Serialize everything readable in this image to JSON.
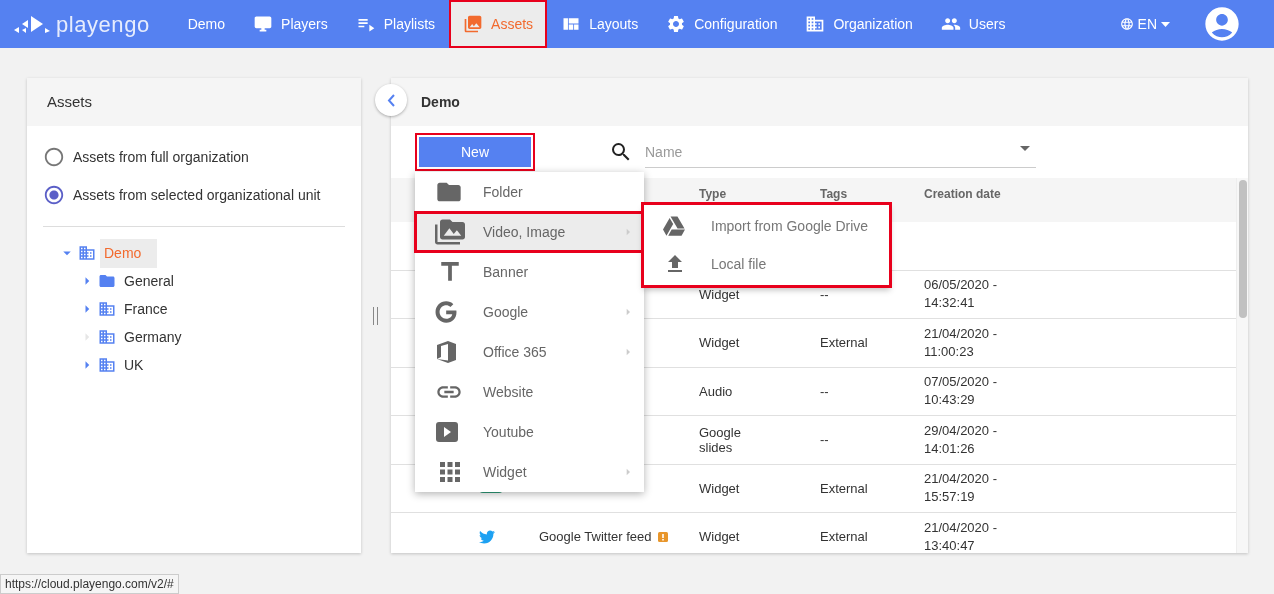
{
  "nav": {
    "logo": "playengo",
    "items": [
      {
        "label": "Demo",
        "selected": false,
        "annotated": false
      },
      {
        "label": "Players",
        "selected": false,
        "annotated": false
      },
      {
        "label": "Playlists",
        "selected": false,
        "annotated": false
      },
      {
        "label": "Assets",
        "selected": true,
        "annotated": true
      },
      {
        "label": "Layouts",
        "selected": false,
        "annotated": false
      },
      {
        "label": "Configuration",
        "selected": false,
        "annotated": false
      },
      {
        "label": "Organization",
        "selected": false,
        "annotated": false
      },
      {
        "label": "Users",
        "selected": false,
        "annotated": false
      }
    ],
    "language": "EN"
  },
  "sidebar": {
    "title": "Assets",
    "scope_options": [
      {
        "label": "Assets from full organization",
        "selected": false
      },
      {
        "label": "Assets from selected organizational unit",
        "selected": true
      }
    ],
    "tree": [
      {
        "label": "Demo",
        "kind": "unit",
        "expanded": true,
        "selected": true,
        "children": [
          {
            "label": "General",
            "kind": "folder",
            "expanded": false,
            "selected": false,
            "has_children": true
          },
          {
            "label": "France",
            "kind": "unit",
            "expanded": false,
            "selected": false,
            "has_children": true
          },
          {
            "label": "Germany",
            "kind": "unit",
            "expanded": false,
            "selected": false,
            "has_children": false
          },
          {
            "label": "UK",
            "kind": "unit",
            "expanded": false,
            "selected": false,
            "has_children": true
          }
        ]
      }
    ]
  },
  "content": {
    "title": "Demo",
    "new_button": {
      "label": "New",
      "annotated": true
    },
    "search": {
      "placeholder": "Name"
    },
    "table": {
      "columns": [
        "Type",
        "Tags",
        "Creation date"
      ],
      "rows": [
        {},
        {
          "type": "Widget",
          "tags": "--",
          "created": "06/05/2020 - 14:32:41"
        },
        {
          "type": "Widget",
          "tags": "External",
          "created": "21/04/2020 - 11:00:23"
        },
        {
          "type": "Audio",
          "tags": "--",
          "created": "07/05/2020 - 10:43:29"
        },
        {
          "type": "Google slides",
          "tags": "--",
          "created": "29/04/2020 - 14:01:26"
        },
        {
          "kind": "widget",
          "type": "Widget",
          "tags": "External",
          "created": "21/04/2020 - 15:57:19"
        },
        {
          "kind": "twitter_widget",
          "name": "Google Twitter feed",
          "warning": true,
          "type": "Widget",
          "tags": "External",
          "created": "21/04/2020 - 13:40:47"
        }
      ]
    },
    "new_menu": {
      "items": [
        {
          "label": "Folder",
          "has_submenu": false,
          "hovered": false,
          "annotated": false
        },
        {
          "label": "Video, Image",
          "has_submenu": true,
          "hovered": true,
          "annotated": true
        },
        {
          "label": "Banner",
          "has_submenu": false,
          "hovered": false,
          "annotated": false
        },
        {
          "label": "Google",
          "has_submenu": true,
          "hovered": false,
          "annotated": false
        },
        {
          "label": "Office 365",
          "has_submenu": true,
          "hovered": false,
          "annotated": false
        },
        {
          "label": "Website",
          "has_submenu": false,
          "hovered": false,
          "annotated": false
        },
        {
          "label": "Youtube",
          "has_submenu": false,
          "hovered": false,
          "annotated": false
        },
        {
          "label": "Widget",
          "has_submenu": true,
          "hovered": false,
          "annotated": false
        }
      ]
    },
    "submenu": {
      "annotated": true,
      "items": [
        {
          "label": "Import from Google Drive"
        },
        {
          "label": "Local file"
        }
      ]
    }
  },
  "status_bar": {
    "url": "https://cloud.playengo.com/v2/#"
  }
}
